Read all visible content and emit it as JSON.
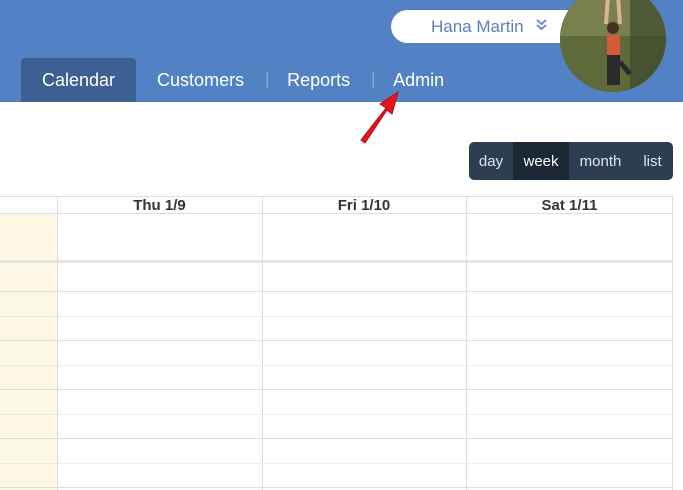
{
  "header": {
    "user_name": "Hana Martin",
    "user_menu_icon": "double-chevron-down-icon",
    "nav": [
      {
        "label": "Calendar",
        "active": true
      },
      {
        "label": "Customers",
        "active": false
      },
      {
        "label": "Reports",
        "active": false
      },
      {
        "label": "Admin",
        "active": false
      }
    ]
  },
  "view_buttons": [
    {
      "label": "day",
      "active": false
    },
    {
      "label": "week",
      "active": true
    },
    {
      "label": "month",
      "active": false
    },
    {
      "label": "list",
      "active": false
    }
  ],
  "calendar": {
    "columns": [
      "Thu 1/9",
      "Fri 1/10",
      "Sat 1/11"
    ]
  },
  "colors": {
    "header_bg": "#5282c3",
    "active_tab": "#3d5f92",
    "view_bar": "#2e3e52",
    "today_highlight": "#fcf8e3",
    "annotation_arrow": "#e8141b"
  }
}
